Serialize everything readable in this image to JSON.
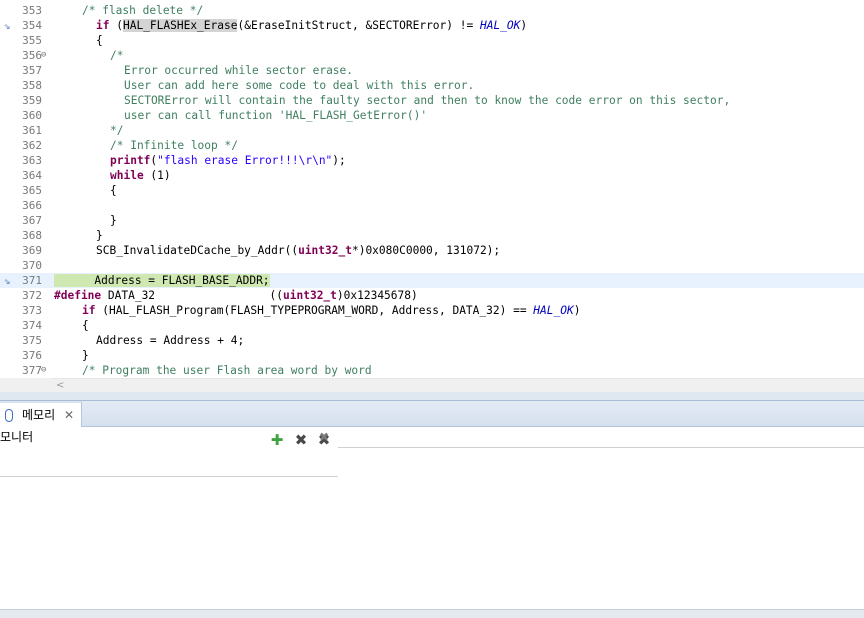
{
  "editor": {
    "lines": [
      {
        "num": "353",
        "fold": "",
        "mark": "",
        "indent": 2,
        "segs": [
          [
            "c",
            "/* flash delete */"
          ]
        ]
      },
      {
        "num": "354",
        "fold": "",
        "mark": "bookmark",
        "indent": 3,
        "segs": [
          [
            "k",
            "if"
          ],
          [
            "",
            " ("
          ],
          [
            "occ",
            "HAL_FLASHEx_Erase"
          ],
          [
            "",
            "(&EraseInitStruct, &SECTORError) != "
          ],
          [
            "m",
            "HAL_OK"
          ],
          [
            "",
            ")"
          ]
        ]
      },
      {
        "num": "355",
        "fold": "",
        "mark": "",
        "indent": 3,
        "segs": [
          [
            "",
            "{"
          ]
        ]
      },
      {
        "num": "356",
        "fold": "⊖",
        "mark": "",
        "indent": 4,
        "segs": [
          [
            "c",
            "/*"
          ]
        ]
      },
      {
        "num": "357",
        "fold": "",
        "mark": "",
        "indent": 5,
        "segs": [
          [
            "c",
            "Error occurred while sector erase."
          ]
        ]
      },
      {
        "num": "358",
        "fold": "",
        "mark": "",
        "indent": 5,
        "segs": [
          [
            "c",
            "User can add here some code to deal with this error."
          ]
        ]
      },
      {
        "num": "359",
        "fold": "",
        "mark": "",
        "indent": 5,
        "segs": [
          [
            "c",
            "SECTORError will contain the faulty sector and then to know the code error on this sector,"
          ]
        ]
      },
      {
        "num": "360",
        "fold": "",
        "mark": "",
        "indent": 5,
        "segs": [
          [
            "c",
            "user can call function 'HAL_FLASH_GetError()'"
          ]
        ]
      },
      {
        "num": "361",
        "fold": "",
        "mark": "",
        "indent": 4,
        "segs": [
          [
            "c",
            "*/"
          ]
        ]
      },
      {
        "num": "362",
        "fold": "",
        "mark": "",
        "indent": 4,
        "segs": [
          [
            "c",
            "/* Infinite loop */"
          ]
        ]
      },
      {
        "num": "363",
        "fold": "",
        "mark": "",
        "indent": 4,
        "segs": [
          [
            "k",
            "printf"
          ],
          [
            "",
            "("
          ],
          [
            "s",
            "\"flash erase Error!!!\\r\\n\""
          ],
          [
            "",
            ");"
          ]
        ]
      },
      {
        "num": "364",
        "fold": "",
        "mark": "",
        "indent": 4,
        "segs": [
          [
            "k",
            "while"
          ],
          [
            "",
            " (1)"
          ]
        ]
      },
      {
        "num": "365",
        "fold": "",
        "mark": "",
        "indent": 4,
        "segs": [
          [
            "",
            "{"
          ]
        ]
      },
      {
        "num": "366",
        "fold": "",
        "mark": "",
        "indent": 4,
        "segs": [
          [
            "",
            ""
          ]
        ]
      },
      {
        "num": "367",
        "fold": "",
        "mark": "",
        "indent": 4,
        "segs": [
          [
            "",
            "}"
          ]
        ]
      },
      {
        "num": "368",
        "fold": "",
        "mark": "",
        "indent": 3,
        "segs": [
          [
            "",
            "}"
          ]
        ]
      },
      {
        "num": "369",
        "fold": "",
        "mark": "",
        "indent": 3,
        "segs": [
          [
            "",
            "SCB_InvalidateDCache_by_Addr(("
          ],
          [
            "k",
            "uint32_t"
          ],
          [
            "",
            "*)0x080C0000, 131072);"
          ]
        ]
      },
      {
        "num": "370",
        "fold": "",
        "mark": "",
        "indent": 3,
        "segs": [
          [
            "",
            ""
          ]
        ]
      },
      {
        "num": "371",
        "fold": "",
        "mark": "breakpoint",
        "indent": 0,
        "current": true,
        "segs": [
          [
            "linehl",
            "      Address = FLASH_BASE_ADDR;"
          ]
        ]
      },
      {
        "num": "372",
        "fold": "",
        "mark": "",
        "indent": 0,
        "segs": [
          [
            "k",
            "#define"
          ],
          [
            "",
            " DATA_32                 (("
          ],
          [
            "k",
            "uint32_t"
          ],
          [
            "",
            ")0x12345678)"
          ]
        ]
      },
      {
        "num": "373",
        "fold": "",
        "mark": "",
        "indent": 2,
        "segs": [
          [
            "k",
            "if"
          ],
          [
            "",
            " (HAL_FLASH_Program(FLASH_TYPEPROGRAM_WORD, Address, DATA_32) == "
          ],
          [
            "m",
            "HAL_OK"
          ],
          [
            "",
            ")"
          ]
        ]
      },
      {
        "num": "374",
        "fold": "",
        "mark": "",
        "indent": 2,
        "segs": [
          [
            "",
            "{"
          ]
        ]
      },
      {
        "num": "375",
        "fold": "",
        "mark": "",
        "indent": 3,
        "segs": [
          [
            "",
            "Address = Address + 4;"
          ]
        ]
      },
      {
        "num": "376",
        "fold": "",
        "mark": "",
        "indent": 2,
        "segs": [
          [
            "",
            "}"
          ]
        ]
      },
      {
        "num": "377",
        "fold": "⊖",
        "mark": "",
        "indent": 2,
        "segs": [
          [
            "c",
            "/* Program the user Flash area word by word"
          ]
        ]
      }
    ],
    "scroll_left_arrow": "<"
  },
  "memory_view": {
    "tab_label": "메모리",
    "tab_close": "✕",
    "monitors_title": "모니터",
    "add_icon": "✚",
    "remove_icon": "✖",
    "remove_all_icon": "✖"
  },
  "colors": {
    "keyword": "#7f0055",
    "comment": "#3f7f5f",
    "string": "#2a00ff",
    "macro": "#0000c0",
    "current_line": "#e8f2fe",
    "line_highlight": "#cfe8b2"
  }
}
